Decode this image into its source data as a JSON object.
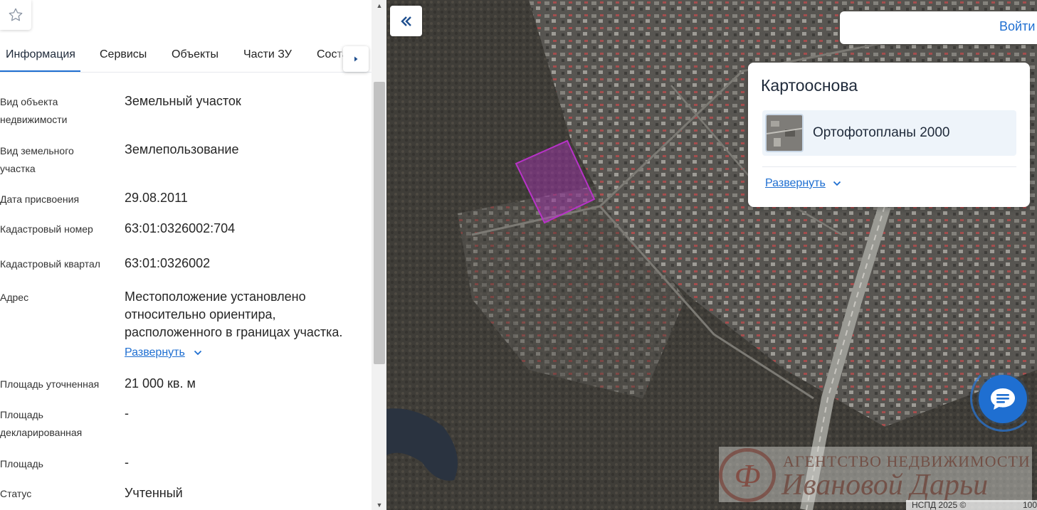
{
  "tabs": [
    {
      "label": "Информация",
      "active": true
    },
    {
      "label": "Сервисы"
    },
    {
      "label": "Объекты"
    },
    {
      "label": "Части ЗУ"
    },
    {
      "label": "Состав"
    }
  ],
  "info": {
    "object_type_label": "Вид объекта недвижимости",
    "object_type_value": "Земельный участок",
    "land_type_label": "Вид земельного участка",
    "land_type_value": "Землепользование",
    "date_label": "Дата присвоения",
    "date_value": "29.08.2011",
    "cadastral_number_label": "Кадастровый номер",
    "cadastral_number_value": "63:01:0326002:704",
    "cadastral_quarter_label": "Кадастровый квартал",
    "cadastral_quarter_value": "63:01:0326002",
    "address_label": "Адрес",
    "address_value": "Местоположение установлено относительно ориентира, расположенного в границах участка.",
    "address_expand": "Развернуть",
    "area_specified_label": "Площадь уточненная",
    "area_specified_value": "21 000 кв. м",
    "area_declared_label": "Площадь декларированная",
    "area_declared_value": "-",
    "area_label": "Площадь",
    "area_value": "-",
    "status_label": "Статус",
    "status_value": "Учтенный"
  },
  "map": {
    "login": "Войти",
    "basemap_title": "Картооснова",
    "basemap_item": "Ортофотопланы 2000",
    "basemap_expand": "Развернуть",
    "attribution": "НСПД 2025 ©",
    "scale_text": "100",
    "watermark_line1": "АГЕНТСТВО НЕДВИЖИМОСТИ",
    "watermark_line2": "Ивановой Дарьи",
    "parcel_color": "#b832c8"
  },
  "icons": {
    "star": "star-icon",
    "collapse": "double-chevron-left-icon",
    "tab_next": "triangle-right-icon",
    "chat": "chat-icon"
  }
}
